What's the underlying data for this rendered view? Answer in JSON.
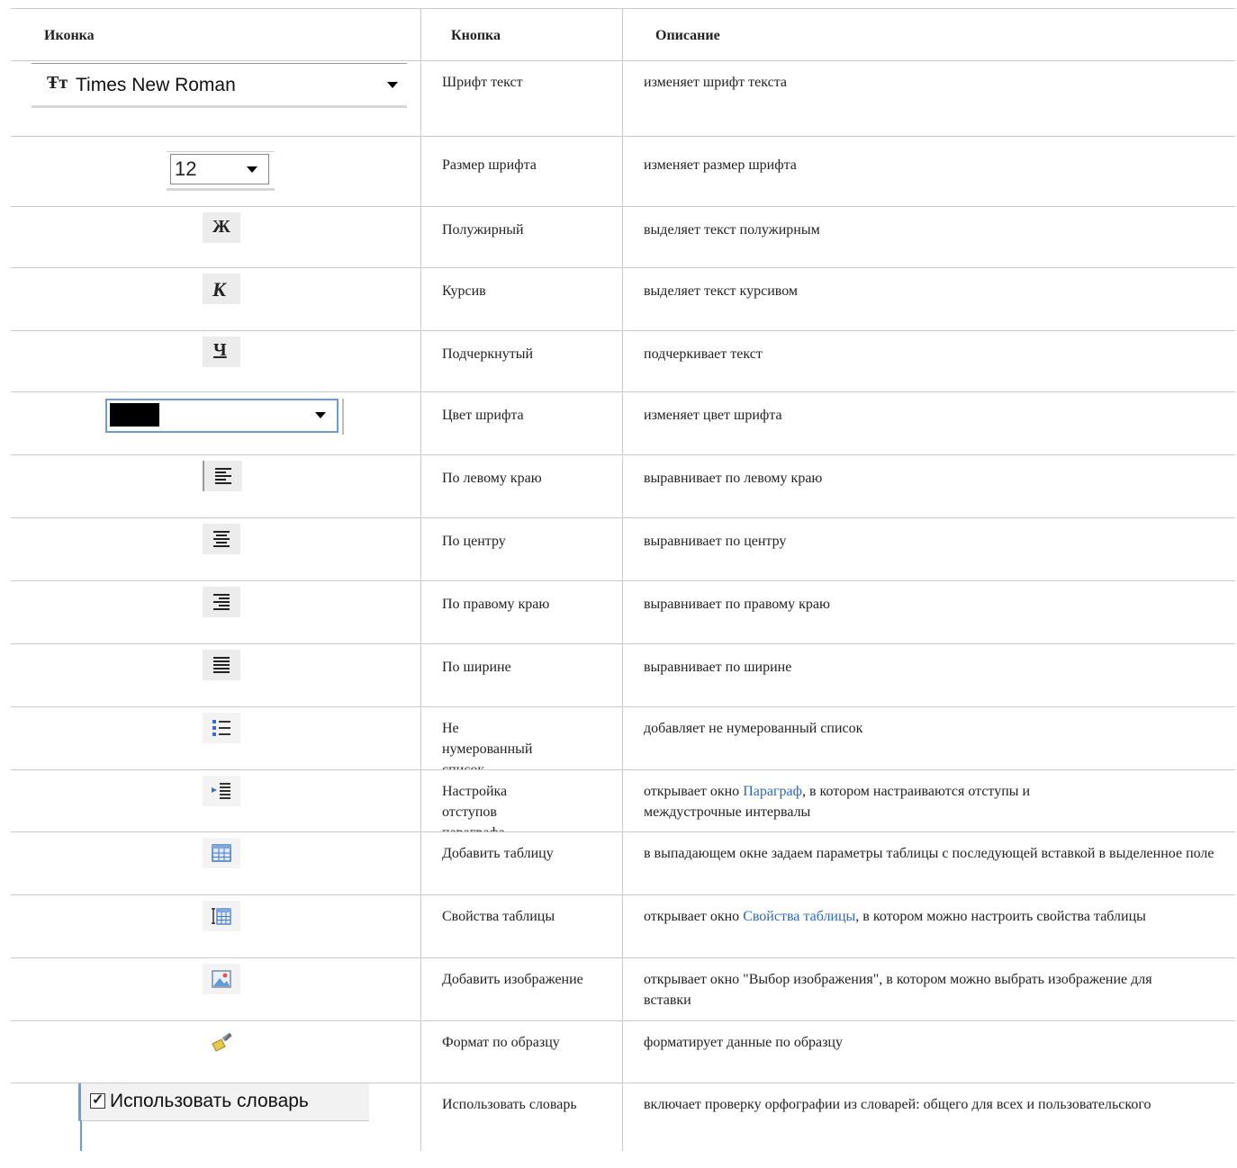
{
  "headers": {
    "icon": "Иконка",
    "button": "Кнопка",
    "description": "Описание"
  },
  "widgets": {
    "font_combo_value": "Times New Roman",
    "font_combo_glyph": "Ŧт",
    "size_combo_value": "12",
    "color_combo_value": "#000000",
    "dict_checkbox_label": "Использовать словарь",
    "dict_checkbox_checked": true
  },
  "rows": [
    {
      "icon": "font-family-combo",
      "button": "Шрифт текст",
      "description": "изменяет шрифт текста"
    },
    {
      "icon": "font-size-combo",
      "button": "Размер шрифта",
      "description": "изменяет размер шрифта"
    },
    {
      "icon": "bold-icon",
      "glyph": "Ж",
      "button": "Полужирный",
      "description": "выделяет текст полужирным"
    },
    {
      "icon": "italic-icon",
      "glyph": "К",
      "button": "Курсив",
      "description": "выделяет текст курсивом"
    },
    {
      "icon": "underline-icon",
      "glyph": "Ч",
      "button": "Подчеркнутый",
      "description": "подчеркивает текст"
    },
    {
      "icon": "font-color-combo",
      "button": "Цвет шрифта",
      "description": "изменяет цвет шрифта"
    },
    {
      "icon": "align-left-icon",
      "button": "По левому краю",
      "description": "выравнивает по левому краю"
    },
    {
      "icon": "align-center-icon",
      "button": "По центру",
      "description": "выравнивает по центру"
    },
    {
      "icon": "align-right-icon",
      "button": "По правому краю",
      "description": "выравнивает по правому краю"
    },
    {
      "icon": "align-justify-icon",
      "button": "По ширине",
      "description": "выравнивает по ширине"
    },
    {
      "icon": "bullet-list-icon",
      "button": "Не нумерованный список",
      "description": "добавляет не нумерованный список"
    },
    {
      "icon": "paragraph-indent-icon",
      "button": "Настройка отступов параграфа",
      "description_pre": "открывает окно ",
      "description_link": "Параграф",
      "description_post": ", в котором настраиваются отступы и междустрочные интервалы"
    },
    {
      "icon": "insert-table-icon",
      "button": "Добавить таблицу",
      "description": "в выпадающем окне задаем параметры таблицы с последующей вставкой в выделенное поле"
    },
    {
      "icon": "table-properties-icon",
      "button": "Свойства таблицы",
      "description_pre": "открывает окно ",
      "description_link": "Свойства таблицы",
      "description_post": ", в котором можно настроить свойства таблицы"
    },
    {
      "icon": "insert-image-icon",
      "button": "Добавить изображение",
      "description": "открывает окно \"Выбор изображения\", в котором можно выбрать изображение для вставки"
    },
    {
      "icon": "format-painter-icon",
      "button": "Формат по образцу",
      "description": "форматирует данные по образцу"
    },
    {
      "icon": "spellcheck-dictionary-checkbox",
      "button": "Использовать словарь",
      "description": "включает проверку орфографии из словарей: общего для всех и пользовательского"
    }
  ]
}
